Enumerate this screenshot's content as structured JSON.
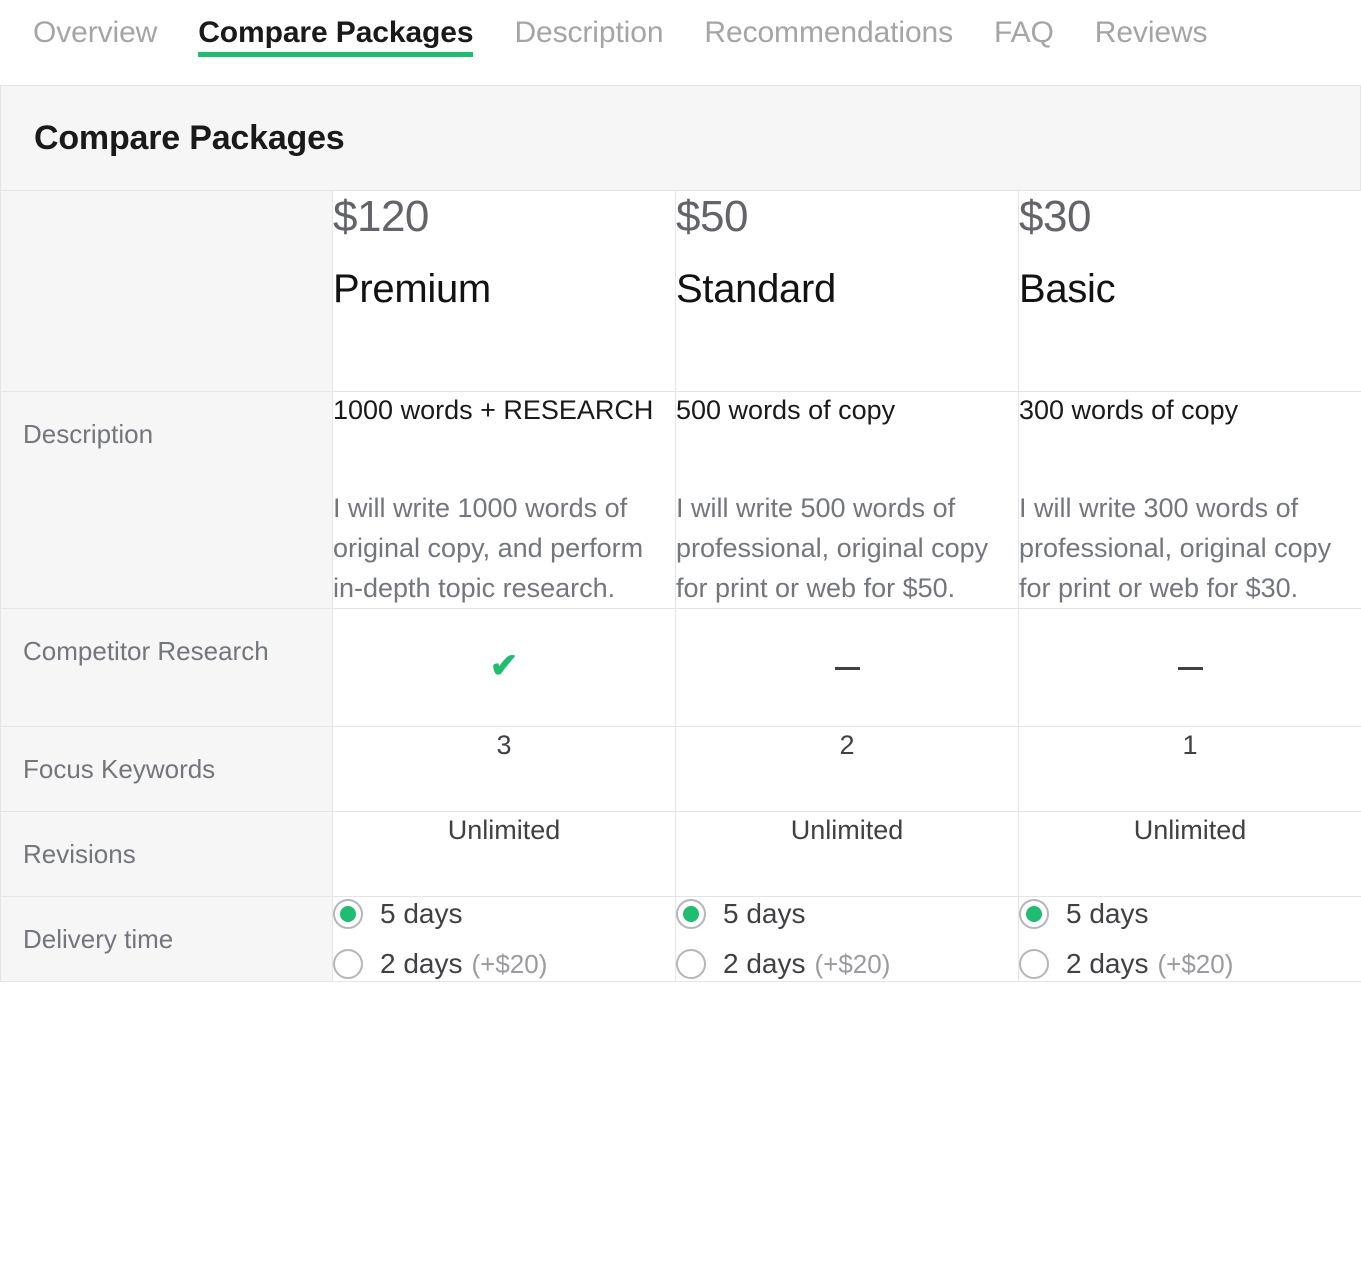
{
  "tabs": [
    {
      "label": "Overview",
      "active": false
    },
    {
      "label": "Compare Packages",
      "active": true
    },
    {
      "label": "Description",
      "active": false
    },
    {
      "label": "Recommendations",
      "active": false
    },
    {
      "label": "FAQ",
      "active": false
    },
    {
      "label": "Reviews",
      "active": false
    }
  ],
  "section": {
    "title": "Compare Packages"
  },
  "colors": {
    "accent_green": "#21bb72",
    "label_gray": "#74767e",
    "price_gray": "#62646a",
    "body_text": "#404145",
    "muted": "#9a9ba1",
    "border": "#e4e5e7",
    "label_bg": "#f6f6f6"
  },
  "packages": [
    {
      "price": "$120",
      "name": "Premium"
    },
    {
      "price": "$50",
      "name": "Standard"
    },
    {
      "price": "$30",
      "name": "Basic"
    }
  ],
  "rows": {
    "description": {
      "label": "Description",
      "cells": [
        {
          "title": "1000 words + RESEARCH",
          "body": "I will write 1000 words of original copy, and perform in-depth topic research."
        },
        {
          "title": "500 words of copy",
          "body": "I will write 500 words of professional, original copy for print or web for $50."
        },
        {
          "title": "300 words of copy",
          "body": "I will write 300 words of professional, original copy for print or web for $30."
        }
      ]
    },
    "competitor_research": {
      "label": "Competitor Research",
      "cells": [
        {
          "icon": "check-icon",
          "glyph": "✔",
          "type": "check"
        },
        {
          "icon": "dash-icon",
          "glyph": "–",
          "type": "dash"
        },
        {
          "icon": "dash-icon",
          "glyph": "–",
          "type": "dash"
        }
      ]
    },
    "focus_keywords": {
      "label": "Focus Keywords",
      "cells": [
        "3",
        "2",
        "1"
      ]
    },
    "revisions": {
      "label": "Revisions",
      "cells": [
        "Unlimited",
        "Unlimited",
        "Unlimited"
      ]
    },
    "delivery_time": {
      "label": "Delivery time",
      "cells": [
        {
          "options": [
            {
              "label": "5 days",
              "extra": "",
              "selected": true
            },
            {
              "label": "2 days",
              "extra": "(+$20)",
              "selected": false
            }
          ]
        },
        {
          "options": [
            {
              "label": "5 days",
              "extra": "",
              "selected": true
            },
            {
              "label": "2 days",
              "extra": "(+$20)",
              "selected": false
            }
          ]
        },
        {
          "options": [
            {
              "label": "5 days",
              "extra": "",
              "selected": true
            },
            {
              "label": "2 days",
              "extra": "(+$20)",
              "selected": false
            }
          ]
        }
      ]
    }
  }
}
